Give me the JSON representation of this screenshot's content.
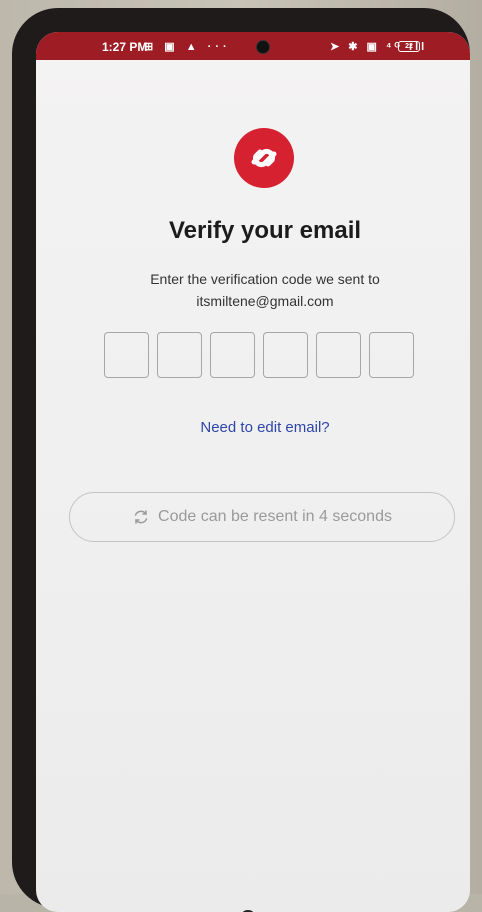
{
  "status_bar": {
    "time": "1:27 PM",
    "left_icons": "⊞ ▣ ▲ ···",
    "right_icons": "➤ ✱ ▣ ⁴ᴳ ıll",
    "battery": "22"
  },
  "title": "Verify your email",
  "subtitle_line1": "Enter the verification code we sent to",
  "subtitle_email": "itsmiltene@gmail.com",
  "code_boxes": [
    "",
    "",
    "",
    "",
    "",
    ""
  ],
  "edit_email_link": "Need to edit email?",
  "resend_button": {
    "label": "Code can be resent in 4 seconds",
    "icon": "refresh-icon"
  },
  "colors": {
    "brand": "#d62131",
    "status_bar": "#9e1c24",
    "link": "#2e46a8",
    "disabled": "#9a9a9a"
  }
}
